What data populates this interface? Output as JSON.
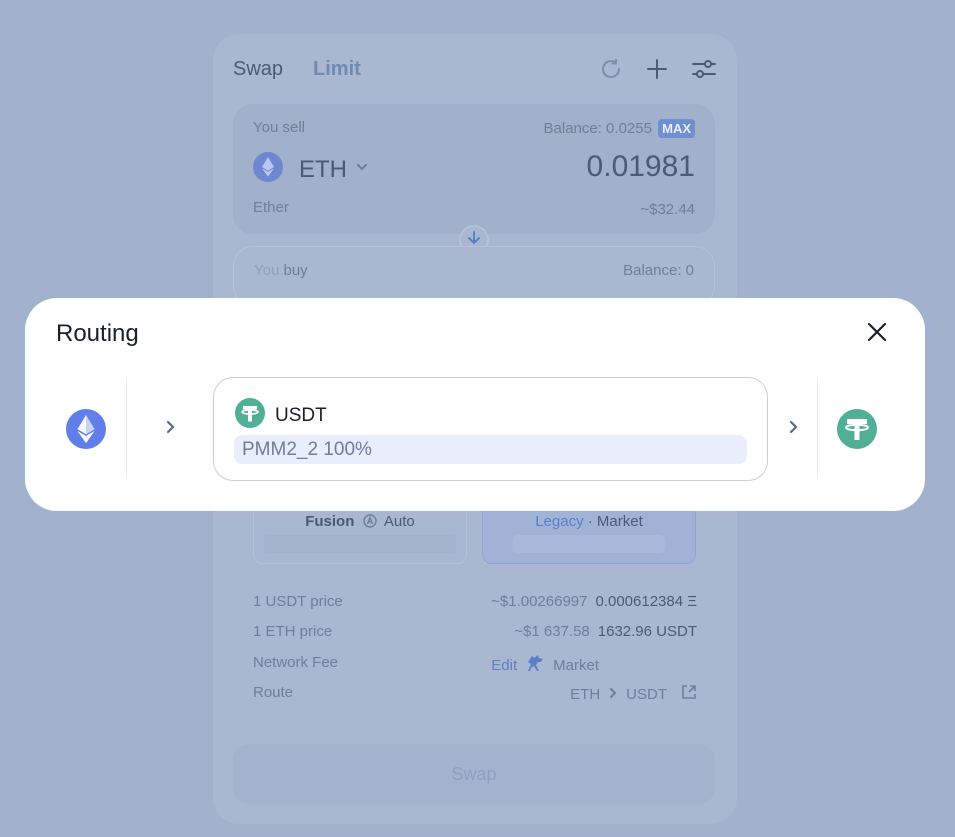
{
  "tabs": {
    "swap": "Swap",
    "limit": "Limit"
  },
  "sell": {
    "label": "You sell",
    "balance": "Balance: 0.0255",
    "max": "MAX",
    "token": "ETH",
    "amount": "0.01981",
    "token_name": "Ether",
    "usd": "~$32.44"
  },
  "buy": {
    "label_you": "You",
    "label_buy": "buy",
    "balance": "Balance: 0"
  },
  "modes": {
    "fusion": "Fusion",
    "auto": "Auto",
    "legacy": "Legacy",
    "market": "· Market"
  },
  "info": {
    "usdt_price_label": "1 USDT price",
    "usdt_price_usd": "~$1.00266997",
    "usdt_price_eth": "0.000612384 Ξ",
    "eth_price_label": "1 ETH price",
    "eth_price_usd": "~$1 637.58",
    "eth_price_usdt": "1632.96 USDT",
    "fee_label": "Network Fee",
    "fee_edit": "Edit",
    "fee_mode": "Market",
    "route_label": "Route",
    "route_from": "ETH",
    "route_to": "USDT"
  },
  "swap_button": "Swap",
  "modal": {
    "title": "Routing",
    "token": "USDT",
    "pool": "PMM2_2 100%"
  },
  "colors": {
    "eth": "#627eea",
    "usdt": "#50af95",
    "backdrop": "#a2b2ce"
  }
}
